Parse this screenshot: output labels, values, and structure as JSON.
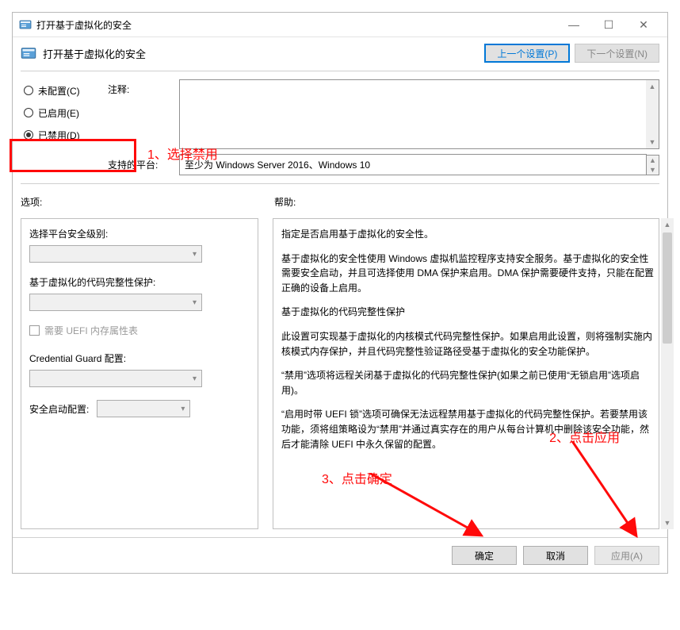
{
  "window": {
    "title": "打开基于虚拟化的安全"
  },
  "header": {
    "title": "打开基于虚拟化的安全",
    "prev": "上一个设置(P)",
    "next": "下一个设置(N)"
  },
  "radios": {
    "not_configured": "未配置(C)",
    "enabled": "已启用(E)",
    "disabled": "已禁用(D)"
  },
  "labels": {
    "comment": "注释:",
    "supported": "支持的平台:",
    "options": "选项:",
    "help": "帮助:"
  },
  "supported_text": "至少为 Windows Server 2016、Windows 10",
  "options": {
    "platform_label": "选择平台安全级别:",
    "codeintegrity_label": "基于虚拟化的代码完整性保护:",
    "uefi_checkbox": "需要 UEFI 内存属性表",
    "cg_label": "Credential Guard 配置:",
    "secureboot_label": "安全启动配置:"
  },
  "help": {
    "p1": "指定是否启用基于虚拟化的安全性。",
    "p2": "基于虚拟化的安全性使用 Windows 虚拟机监控程序支持安全服务。基于虚拟化的安全性需要安全启动，并且可选择使用 DMA 保护来启用。DMA 保护需要硬件支持，只能在配置正确的设备上启用。",
    "p3": "基于虚拟化的代码完整性保护",
    "p4": "此设置可实现基于虚拟化的内核模式代码完整性保护。如果启用此设置，则将强制实施内核模式内存保护，并且代码完整性验证路径受基于虚拟化的安全功能保护。",
    "p5": "“禁用”选项将远程关闭基于虚拟化的代码完整性保护(如果之前已使用“无锁启用”选项启用)。",
    "p6": "“启用时带 UEFI 锁”选项可确保无法远程禁用基于虚拟化的代码完整性保护。若要禁用该功能，须将组策略设为“禁用”并通过真实存在的用户从每台计算机中删除该安全功能，然后才能清除 UEFI 中永久保留的配置。"
  },
  "footer": {
    "ok": "确定",
    "cancel": "取消",
    "apply": "应用(A)"
  },
  "annotations": {
    "a1": "1、选择禁用",
    "a2": "2、点击应用",
    "a3": "3、点击确定"
  }
}
